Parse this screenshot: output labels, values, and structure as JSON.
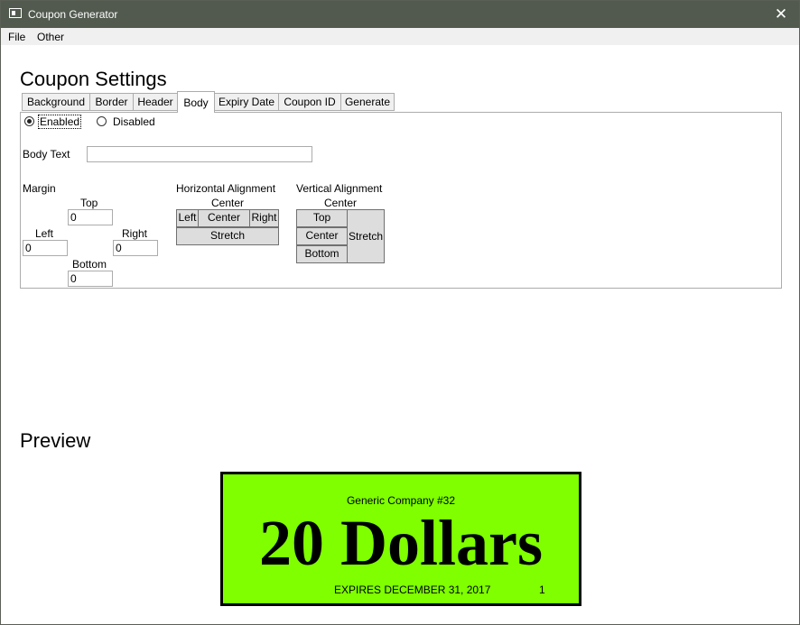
{
  "window": {
    "title": "Coupon Generator",
    "close_glyph": "✕"
  },
  "menu": {
    "items": [
      "File",
      "Other"
    ]
  },
  "settings": {
    "heading": "Coupon Settings",
    "tabs": [
      "Background",
      "Border",
      "Header",
      "Body",
      "Expiry Date",
      "Coupon ID",
      "Generate"
    ],
    "active_tab": "Body"
  },
  "body_tab": {
    "enabled_label": "Enabled",
    "disabled_label": "Disabled",
    "enabled_checked": true,
    "body_text_label": "Body Text",
    "body_text_value": "",
    "margin": {
      "label": "Margin",
      "top_label": "Top",
      "top": "0",
      "left_label": "Left",
      "left": "0",
      "right_label": "Right",
      "right": "0",
      "bottom_label": "Bottom",
      "bottom": "0"
    },
    "horizontal": {
      "label": "Horizontal Alignment",
      "current": "Center",
      "left": "Left",
      "center": "Center",
      "right": "Right",
      "stretch": "Stretch"
    },
    "vertical": {
      "label": "Vertical Alignment",
      "current": "Center",
      "top": "Top",
      "center": "Center",
      "bottom": "Bottom",
      "stretch": "Stretch"
    }
  },
  "preview": {
    "heading": "Preview",
    "background_color": "#7fff00",
    "border_color": "#000000",
    "header": "Generic Company #32",
    "body": "20 Dollars",
    "expiry": "EXPIRES DECEMBER 31, 2017",
    "coupon_id": "1"
  }
}
